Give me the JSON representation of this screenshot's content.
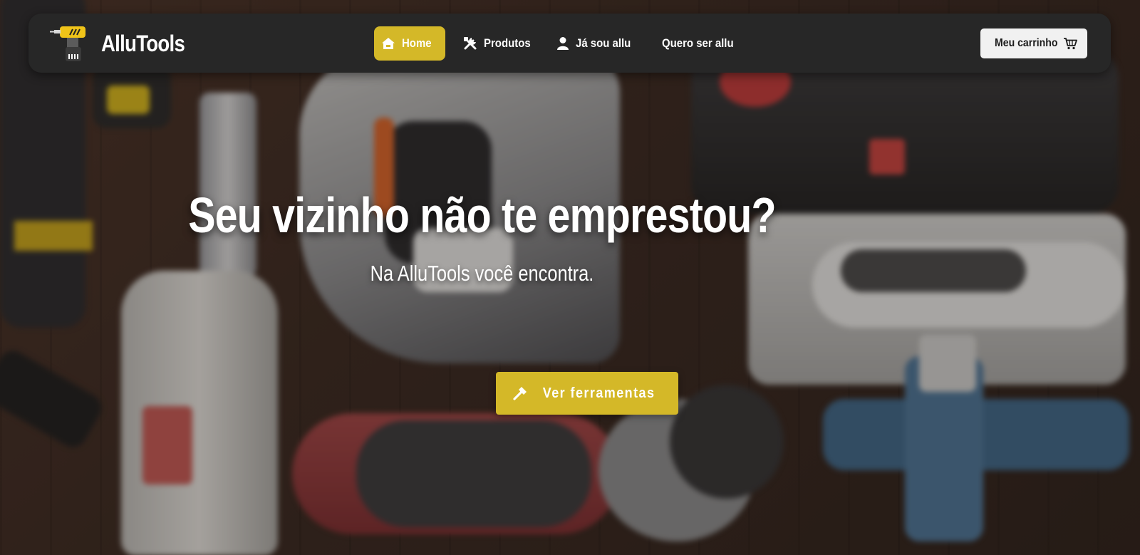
{
  "brand": {
    "name": "AlluTools",
    "logo_icon": "drill-icon"
  },
  "nav": {
    "items": [
      {
        "label": "Home",
        "icon": "home-icon",
        "active": true
      },
      {
        "label": "Produtos",
        "icon": "tools-icon",
        "active": false
      },
      {
        "label": "Já sou allu",
        "icon": "user-icon",
        "active": false
      },
      {
        "label": "Quero ser allu",
        "icon": "",
        "active": false
      }
    ],
    "cart": {
      "label": "Meu carrinho",
      "icon": "cart-icon"
    }
  },
  "hero": {
    "title": "Seu vizinho não te emprestou?",
    "subtitle": "Na AlluTools você encontra.",
    "cta_label": "Ver ferramentas",
    "cta_icon": "hammer-icon"
  },
  "colors": {
    "accent": "#d4b828",
    "navbar_bg": "#272727",
    "cart_bg": "#f1f1f1",
    "text_light": "#ffffff"
  }
}
